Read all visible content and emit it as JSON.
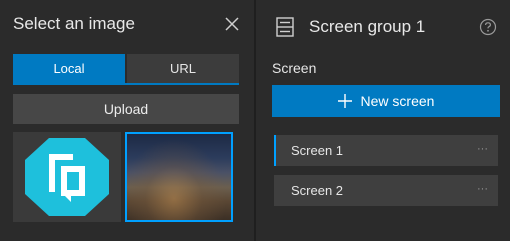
{
  "image_picker": {
    "title": "Select an image",
    "tabs": [
      {
        "label": "Local",
        "active": true
      },
      {
        "label": "URL",
        "active": false
      }
    ],
    "upload_label": "Upload"
  },
  "screen_group": {
    "title": "Screen group 1",
    "section_label": "Screen",
    "new_screen_label": "New screen",
    "screens": [
      {
        "label": "Screen 1",
        "selected": true,
        "more": "···"
      },
      {
        "label": "Screen 2",
        "selected": false,
        "more": "···"
      }
    ]
  },
  "colors": {
    "accent": "#007ac2",
    "selection": "#00a0ff",
    "panel_bg": "#2b2b2b",
    "button_bg": "#474747"
  },
  "icons": [
    "close-icon",
    "screen-group-icon",
    "help-icon",
    "plus-icon",
    "more-icon",
    "app-logo-icon"
  ]
}
